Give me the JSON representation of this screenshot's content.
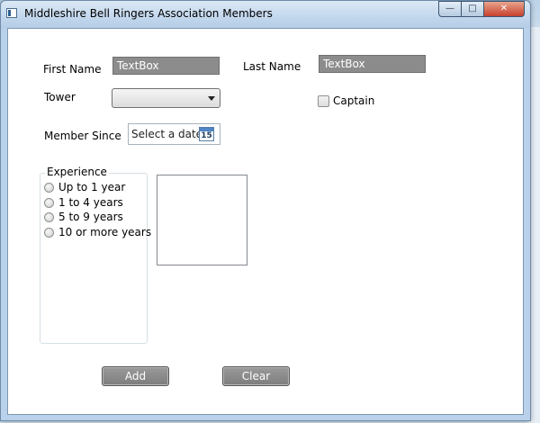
{
  "window": {
    "title": "Middleshire Bell Ringers Association Members",
    "controls": {
      "minimize": "—",
      "maximize": "□",
      "close": "✕"
    }
  },
  "form": {
    "first_name_label": "First Name",
    "first_name_value": "TextBox",
    "last_name_label": "Last Name",
    "last_name_value": "TextBox",
    "tower_label": "Tower",
    "tower_value": "",
    "captain_label": "Captain",
    "member_since_label": "Member Since",
    "member_since_placeholder": "Select a date",
    "calendar_day": "15",
    "experience": {
      "title": "Experience",
      "options": [
        "Up to 1 year",
        "1 to 4 years",
        "5 to 9 years",
        "10 or more years"
      ]
    }
  },
  "buttons": {
    "add": "Add",
    "clear": "Clear"
  }
}
